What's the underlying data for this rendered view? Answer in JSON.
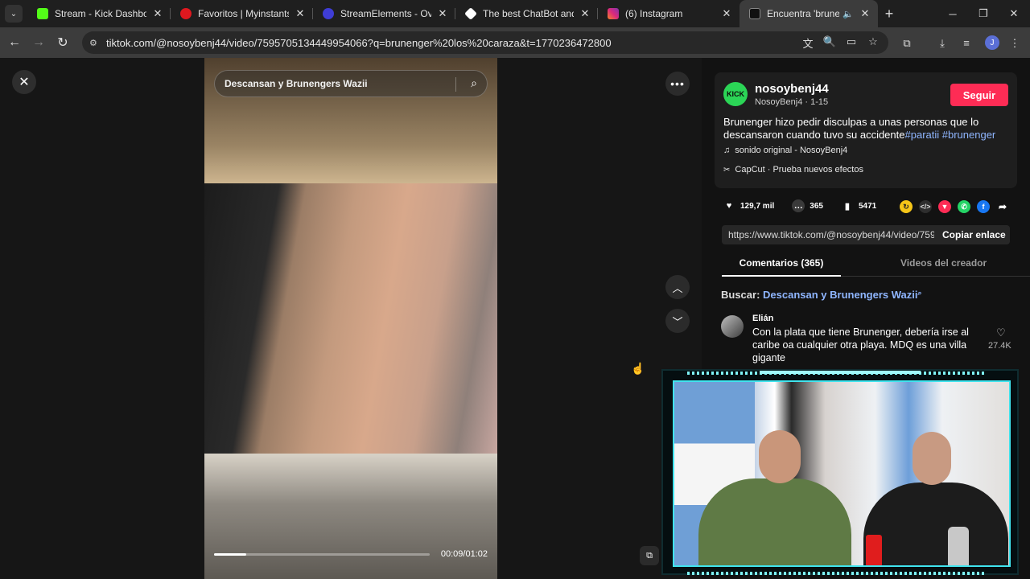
{
  "browser": {
    "tabs": [
      {
        "title": "Stream - Kick Dashboard",
        "favicon": "kick-icon",
        "color": "#53fc18",
        "active": false
      },
      {
        "title": "Favoritos | Myinstants",
        "favicon": "myinstants-icon",
        "color": "#e0181f",
        "active": false
      },
      {
        "title": "StreamElements - Overlays",
        "favicon": "streamelements-icon",
        "color": "#3f3dd6",
        "active": false
      },
      {
        "title": "The best ChatBot and Widg",
        "favicon": "chatbot-icon",
        "color": "#ffffff",
        "active": false
      },
      {
        "title": "(6) Instagram",
        "favicon": "instagram-icon",
        "color": "#dd2a7b",
        "active": false
      },
      {
        "title": "Encuentra 'brunenger",
        "favicon": "tiktok-icon",
        "color": "#ffffff",
        "active": true
      }
    ],
    "url": "tiktok.com/@nosoybenj44/video/7595705134449954066?q=brunenger%20los%20caraza&t=1770236472800",
    "profile_initial": "J"
  },
  "video": {
    "search_text": "Descansan y Brunengers Wazii",
    "time": "00:09/01:02",
    "progress": 0.15
  },
  "post": {
    "avatar_text": "KICK",
    "username": "nosoybenj44",
    "subline": "NosoyBenj4 · 1-15",
    "follow_label": "Seguir",
    "description": "Brunenger hizo pedir disculpas a unas personas que lo descansaron cuando tuvo su accidente",
    "hashtags": "#paratii #brunenger",
    "music": "sonido original - NosoyBenj4",
    "capcut": "CapCut · Prueba nuevos efectos",
    "likes": "129,7 mil",
    "comments_count": "365",
    "saves": "5471",
    "link": "https://www.tiktok.com/@nosoybenj44/video/759...",
    "copy_label": "Copiar enlace",
    "tab_comments": "Comentarios (365)",
    "tab_creator": "Videos del creador",
    "search_label": "Buscar:",
    "search_query": "Descansan y Brunengers Wazii"
  },
  "comments": [
    {
      "author": "Elián",
      "text": "Con la plata que tiene Brunenger, debería irse al caribe oa cualquier otra playa. MDQ es una villa gigante",
      "likes": "27.4K"
    }
  ]
}
